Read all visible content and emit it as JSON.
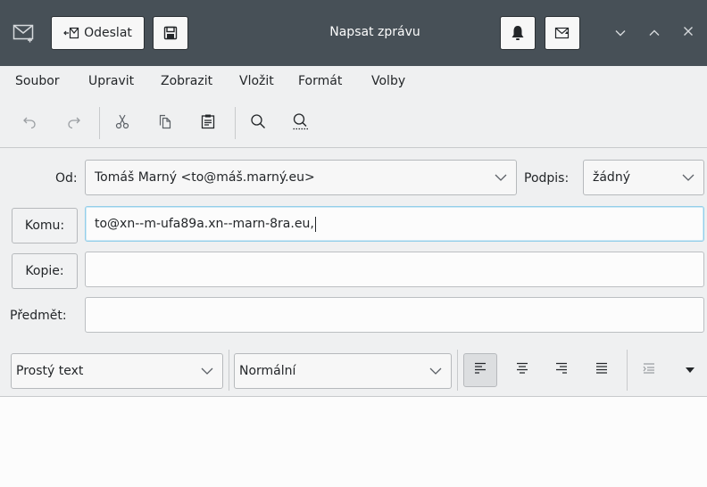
{
  "window": {
    "title": "Napsat zprávu",
    "send_label": "Odeslat",
    "icons": [
      "mail-icon",
      "send-icon",
      "save-icon",
      "bell-icon",
      "mail-receipt-icon",
      "minimize-icon",
      "maximize-icon",
      "close-icon"
    ]
  },
  "menu": {
    "items": [
      "Soubor",
      "Upravit",
      "Zobrazit",
      "Vložit",
      "Formát",
      "Volby"
    ]
  },
  "toolbar": {
    "icons": [
      "undo-icon",
      "redo-icon",
      "cut-icon",
      "copy-icon",
      "paste-icon",
      "find-icon",
      "find-replace-icon"
    ]
  },
  "compose": {
    "from_label": "Od:",
    "from_value": "Tomáš Marný <to@máš.marný.eu>",
    "signature_label": "Podpis:",
    "signature_value": "žádný",
    "to_label": "Komu:",
    "to_value": "to@xn--m-ufa89a.xn--marn-8ra.eu,",
    "cc_label": "Kopie:",
    "cc_value": "",
    "subject_label": "Předmět:",
    "subject_value": ""
  },
  "format": {
    "text_mode": "Prostý text",
    "paragraph_style": "Normální",
    "icons": [
      "align-left-icon",
      "align-center-icon",
      "align-right-icon",
      "align-justify-icon",
      "indent-icon",
      "more-arrow-icon"
    ]
  },
  "colors": {
    "titlebar": "#475057",
    "accent": "#93cee9",
    "window_bg": "#eff0f1"
  }
}
